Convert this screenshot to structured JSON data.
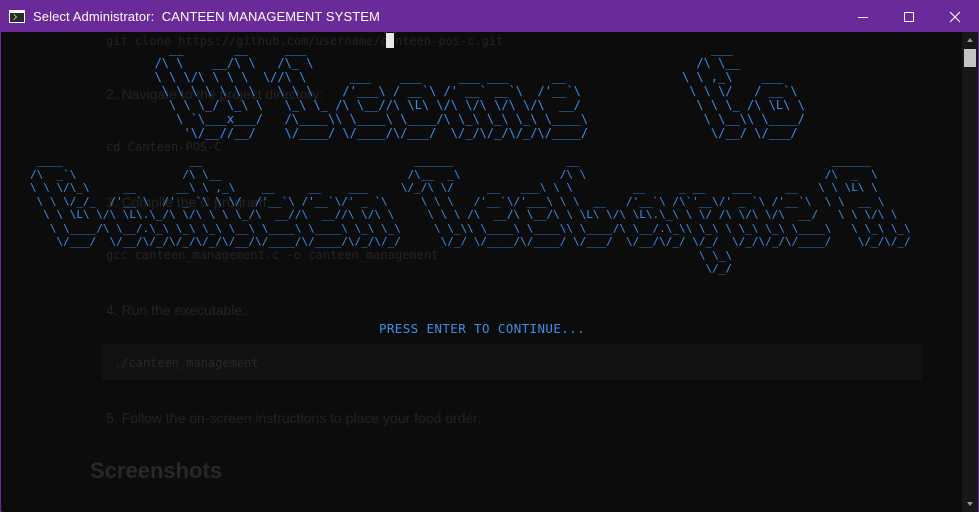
{
  "window": {
    "title": "Select Administrator:  CANTEEN MANAGEMENT SYSTEM",
    "controls": [
      "minimize-icon",
      "maximize-icon",
      "close-icon"
    ],
    "accent_color": "#6b2a99"
  },
  "terminal": {
    "text_color": "#3b8eea",
    "background": "#0c0c0c",
    "ascii_art": {
      "line1": "         __       __     ___                                                        ___\n       /\\ \\    __/\\ \\   /\\_ \\                                                     /\\ \\__\n       \\ \\ \\/\\ \\ \\ \\  \\//\\ \\      ___    ___     ___ ___      __                \\ \\ ,_\\    ___\n        \\ \\ \\ \\ \\ \\ \\   \\ \\ \\    /'___\\ / __`\\ /' __` __`\\  /'__`\\               \\ \\ \\/   / __`\\\n         \\ \\ \\_/ \\_\\ \\   \\_\\ \\_ /\\ \\__//\\ \\L\\ \\/\\ \\/\\ \\/\\ \\/\\  __/                \\ \\ \\_ /\\ \\L\\ \\\n          \\ `\\___x___/   /\\____\\\\ \\____\\ \\____/\\ \\_\\ \\_\\ \\_\\ \\____\\                \\ \\__\\\\ \\____/\n           '\\/__//__/    \\/____/ \\/____/\\/___/  \\/_/\\/_/\\/_/\\/____/                 \\/__/ \\/___/",
      "line2": " ____                   __                                ______                 __                                      ______\n/\\  _`\\                /\\ \\__                            /\\__  _\\               /\\ \\                                    /\\  _  \\\n\\ \\ \\/\\_\\     __      __\\ \\ ,_\\    __     __    ___     \\/_/\\ \\/     __   ___\\ \\ \\         __     _ __    ___     __   \\ \\ \\L\\ \\\n \\ \\ \\/_/_  /'__`\\  /' _ `\\ \\ \\/  /'__`\\ /'__`\\/' _ `\\     \\ \\ \\   /'__`\\/'___\\ \\ \\  __   /'__`\\ /\\`'__\\/' _ `\\ /'__`\\  \\ \\  __ \\\n  \\ \\ \\L\\ \\/\\ \\L\\.\\_/\\ \\/\\ \\ \\ \\_/\\  __//\\  __//\\ \\/\\ \\     \\ \\ \\ /\\  __/\\ \\__/\\ \\ \\L\\ \\/\\ \\L\\.\\_\\ \\ \\/ /\\ \\/\\ \\/\\  __/   \\ \\ \\/\\ \\\n   \\ \\____/\\ \\__/.\\_\\ \\_\\ \\_\\ \\__\\ \\____\\ \\____\\ \\_\\ \\_\\     \\ \\_\\\\ \\____\\ \\____\\\\ \\____/\\ \\__/.\\_\\\\ \\_\\ \\ \\_\\ \\_\\ \\____\\   \\ \\_\\ \\_\\\n    \\/___/  \\/__/\\/_/\\/_/\\/_/\\/__/\\/____/\\/____/\\/_/\\/_/      \\/_/ \\/____/\\/____/ \\/___/  \\/__/\\/_/ \\/_/  \\/_/\\/_/\\/____/    \\/_/\\/_/\n                                                                                                     \\ \\_\\\n                                                                                                      \\/_/"
    },
    "prompt": "PRESS ENTER TO CONTINUE..."
  },
  "background_text": {
    "line_clone": "git clone https://github.com/username/canteen-pos-c.git",
    "line_step2": "2. Navigate to the project directory:",
    "line_cd": "cd Canteen-POS-C",
    "line_step3": "3. Compile the C program:",
    "line_gcc": "gcc canteen_management.c -o canteen_management",
    "line_step4": "4. Run the executable:",
    "line_run": "./canteen_management",
    "line_step5": "5. Follow the on-screen instructions to place your food order.",
    "heading_screenshots": "Screenshots"
  }
}
